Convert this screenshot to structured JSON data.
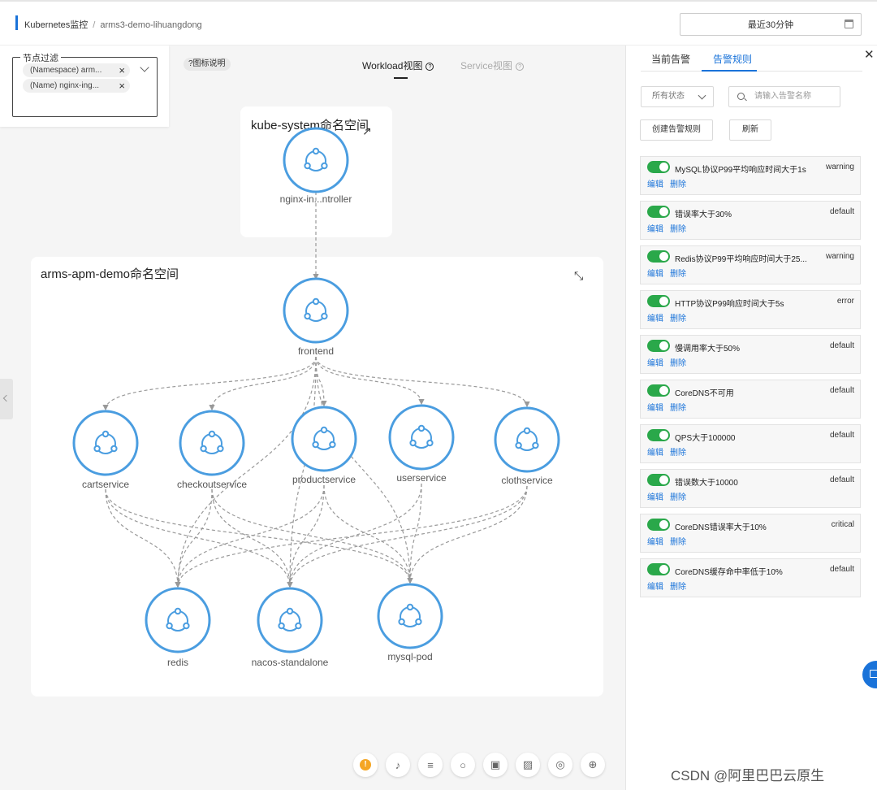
{
  "header": {
    "title": "Kubernetes监控",
    "cluster": "arms3-demo-lihuangdong",
    "time_range": "最近30分钟"
  },
  "filter": {
    "legend": "节点过滤",
    "tags": [
      "(Namespace) arm...",
      "(Name) nginx-ing..."
    ],
    "legend_link": "?图标说明"
  },
  "views": {
    "workload": "Workload视图",
    "service": "Service视图"
  },
  "namespaces": {
    "kube_system": "kube-system命名空间",
    "apm_demo": "arms-apm-demo命名空间"
  },
  "nodes": [
    {
      "id": "nginx",
      "label": "nginx-in...ntroller"
    },
    {
      "id": "frontend",
      "label": "frontend"
    },
    {
      "id": "cart",
      "label": "cartservice"
    },
    {
      "id": "checkout",
      "label": "checkoutservice"
    },
    {
      "id": "product",
      "label": "productservice"
    },
    {
      "id": "user",
      "label": "userservice"
    },
    {
      "id": "cloth",
      "label": "clothservice"
    },
    {
      "id": "redis",
      "label": "redis"
    },
    {
      "id": "nacos",
      "label": "nacos-standalone"
    },
    {
      "id": "mysql",
      "label": "mysql-pod"
    }
  ],
  "edges": [
    [
      "nginx",
      "frontend"
    ],
    [
      "frontend",
      "cart"
    ],
    [
      "frontend",
      "checkout"
    ],
    [
      "frontend",
      "product"
    ],
    [
      "frontend",
      "user"
    ],
    [
      "frontend",
      "cloth"
    ],
    [
      "frontend",
      "redis"
    ],
    [
      "frontend",
      "nacos"
    ],
    [
      "frontend",
      "mysql"
    ],
    [
      "cart",
      "redis"
    ],
    [
      "cart",
      "nacos"
    ],
    [
      "cart",
      "mysql"
    ],
    [
      "checkout",
      "redis"
    ],
    [
      "checkout",
      "nacos"
    ],
    [
      "checkout",
      "mysql"
    ],
    [
      "product",
      "redis"
    ],
    [
      "product",
      "nacos"
    ],
    [
      "product",
      "mysql"
    ],
    [
      "user",
      "nacos"
    ],
    [
      "user",
      "mysql"
    ],
    [
      "cloth",
      "redis"
    ],
    [
      "cloth",
      "nacos"
    ],
    [
      "cloth",
      "mysql"
    ]
  ],
  "panel": {
    "tab_current": "当前告警",
    "tab_rules": "告警规则",
    "status_select": "所有状态",
    "search_placeholder": "请输入告警名称",
    "create_button": "创建告警规则",
    "refresh_button": "刷新",
    "edit_label": "编辑",
    "delete_label": "删除",
    "rules": [
      {
        "name": "MySQL协议P99平均响应时间大于1s",
        "level": "warning"
      },
      {
        "name": "错误率大于30%",
        "level": "default"
      },
      {
        "name": "Redis协议P99平均响应时间大于25...",
        "level": "warning"
      },
      {
        "name": "HTTP协议P99响应时间大于5s",
        "level": "error"
      },
      {
        "name": "慢调用率大于50%",
        "level": "default"
      },
      {
        "name": "CoreDNS不可用",
        "level": "default"
      },
      {
        "name": "QPS大于100000",
        "level": "default"
      },
      {
        "name": "错误数大于10000",
        "level": "default"
      },
      {
        "name": "CoreDNS错误率大于10%",
        "level": "critical"
      },
      {
        "name": "CoreDNS缓存命中率低于10%",
        "level": "default"
      }
    ]
  },
  "watermark": "CSDN @阿里巴巴云原生",
  "colors": {
    "accent": "#1a73d9",
    "node": "#4a9de0",
    "toggle_on": "#2aa84a"
  }
}
